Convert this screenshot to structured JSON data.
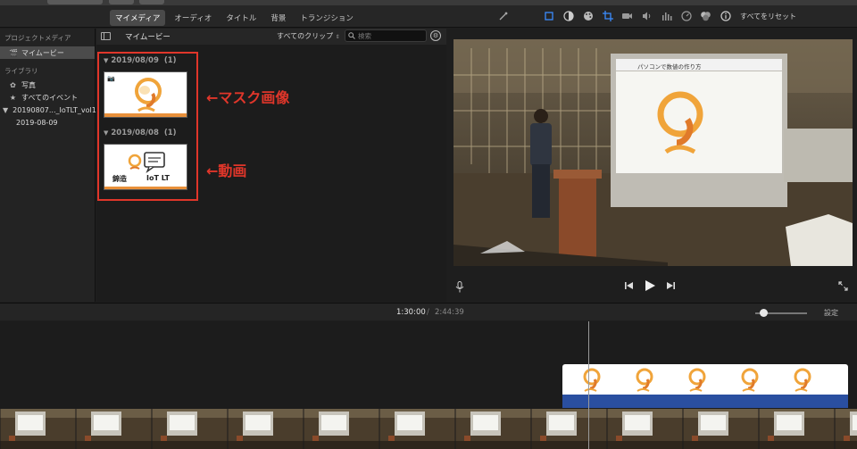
{
  "top_tabs": {
    "my_media": "マイメディア",
    "audio": "オーディオ",
    "titles": "タイトル",
    "backgrounds": "背景",
    "transitions": "トランジション"
  },
  "adjust_bar": {
    "icons": [
      "magic-wand-icon",
      "crop-frame-icon",
      "color-balance-icon",
      "color-palette-icon",
      "crop-icon",
      "stabilization-camera-icon",
      "volume-icon",
      "equalizer-icon",
      "speedometer-icon",
      "filter-icon",
      "info-icon"
    ],
    "reset_label": "すべてをリセット",
    "accent_color": "#3b8cff"
  },
  "sidebar": {
    "project_media_heading": "プロジェクトメディア",
    "my_movie_item": "マイムービー",
    "library_heading": "ライブラリ",
    "photos_item": "写真",
    "all_events_item": "すべてのイベント",
    "library_name": "20190807..._IoTLT_vol1",
    "event_item": "2019-08-09"
  },
  "browser": {
    "title": "マイムービー",
    "clip_filter": "すべてのクリップ",
    "search_placeholder": "検索",
    "events": [
      {
        "date": "2019/08/09",
        "count": "(1)"
      },
      {
        "date": "2019/08/08",
        "count": "(1)"
      }
    ],
    "thumb2_line1": "錦造",
    "thumb2_line2": "IoT LT"
  },
  "annotations": {
    "mask_image": "←マスク画像",
    "video": "←動画",
    "color": "#e0362a"
  },
  "viewer": {
    "slide_header": "パソコンで数値の作り方"
  },
  "timeline": {
    "current_time": "1:30:00",
    "separator": "/",
    "total_time": "2:44:39",
    "settings_label": "設定"
  }
}
